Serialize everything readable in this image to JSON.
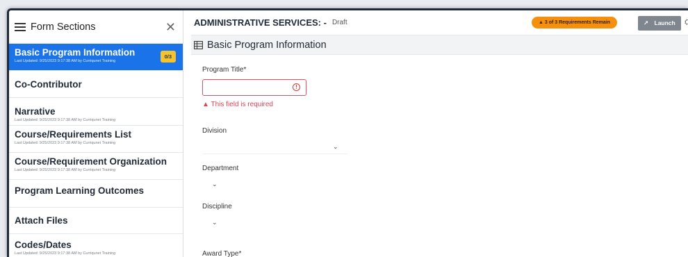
{
  "sidebar": {
    "title": "Form Sections",
    "close_label": "✕",
    "items": [
      {
        "label": "Basic Program Information",
        "sub": "Last Updated: 9/25/2023 9:17:38 AM by Curriqunet Training",
        "badge": "0/3"
      },
      {
        "label": "Co-Contributor",
        "sub": ""
      },
      {
        "label": "Narrative",
        "sub": "Last Updated: 9/25/2023 9:17:38 AM by Curriqunet Training"
      },
      {
        "label": "Course/Requirements List",
        "sub": "Last Updated: 9/25/2023 9:17:38 AM by Curriqunet Training"
      },
      {
        "label": "Course/Requirement Organization",
        "sub": "Last Updated: 9/25/2023 9:17:38 AM by Curriqunet Training"
      },
      {
        "label": "Program Learning Outcomes",
        "sub": ""
      },
      {
        "label": "Attach Files",
        "sub": ""
      },
      {
        "label": "Codes/Dates",
        "sub": "Last Updated: 9/25/2023 9:17:38 AM by Curriqunet Training"
      }
    ]
  },
  "header": {
    "title": "ADMINISTRATIVE SERVICES: -",
    "status": "Draft",
    "requirements_label": "▲ 3 of 3 Requirements Remain",
    "launch_label": "Launch"
  },
  "section": {
    "title": "Basic Program Information"
  },
  "form": {
    "program_title_label": "Program Title*",
    "program_title_value": "",
    "program_title_error": "This field is required",
    "division_label": "Division",
    "department_label": "Department",
    "discipline_label": "Discipline",
    "award_type_label": "Award Type*"
  },
  "colors": {
    "active_item": "#1a73e8",
    "badge": "#f4c430",
    "warning_button": "#f5900f",
    "launch_button": "#7f868e",
    "error": "#d9455a"
  },
  "icons": {
    "menu": "hamburger-icon",
    "close": "close-icon",
    "section": "table-icon",
    "error": "error-circle-icon",
    "warning": "warning-triangle-icon",
    "launch": "external-arrow-icon",
    "settings": "settings-icon",
    "chevron": "chevron-down-icon"
  }
}
